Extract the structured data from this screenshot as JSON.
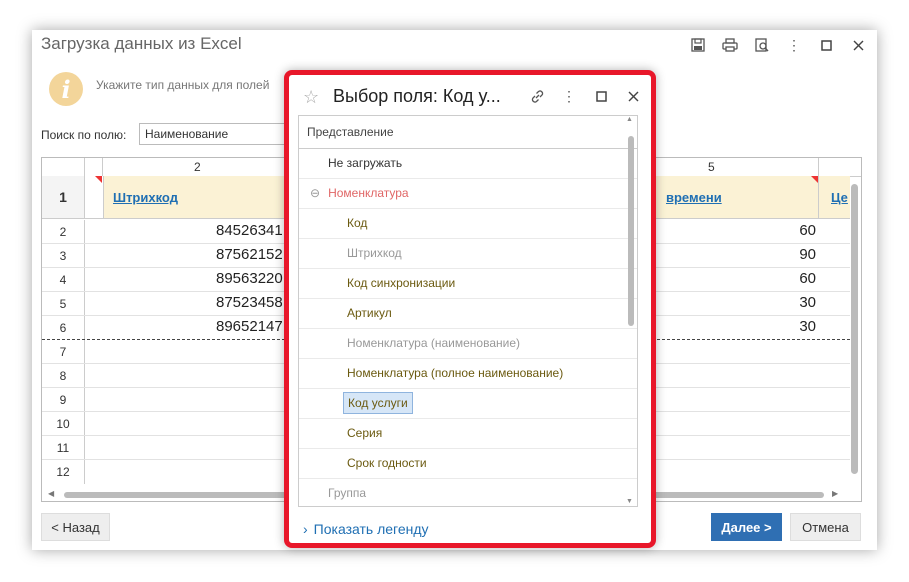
{
  "window": {
    "title": "Загрузка данных из Excel",
    "info_text": "Укажите тип данных для полей",
    "search_label": "Поиск по полю:",
    "search_value": "Наименование",
    "back_label": "< Назад",
    "next_label": "Далее >",
    "cancel_label": "Отмена"
  },
  "grid": {
    "col_numbers": [
      "2",
      "5"
    ],
    "header_links": [
      "Штрихкод",
      "времени",
      "Це"
    ],
    "row_numbers": [
      "1",
      "2",
      "3",
      "4",
      "5",
      "6",
      "7",
      "8",
      "9",
      "10",
      "11",
      "12"
    ],
    "barcodes": [
      "84526341",
      "87562152",
      "89563220",
      "87523458",
      "89652147"
    ],
    "times": [
      "60",
      "90",
      "60",
      "30",
      "30"
    ]
  },
  "modal": {
    "title": "Выбор поля: Код у...",
    "list_header": "Представление",
    "items": [
      {
        "label": "Не загружать"
      },
      {
        "label": "Номенклатура"
      },
      {
        "label": "Код"
      },
      {
        "label": "Штрихкод"
      },
      {
        "label": "Код синхронизации"
      },
      {
        "label": "Артикул"
      },
      {
        "label": "Номенклатура (наименование)"
      },
      {
        "label": "Номенклатура (полное наименование)"
      },
      {
        "label": "Код услуги"
      },
      {
        "label": "Серия"
      },
      {
        "label": "Срок годности"
      },
      {
        "label": "Группа"
      }
    ],
    "legend_label": "Показать легенду"
  },
  "colors": {
    "highlight_border": "#e8172a",
    "accent": "#2f6fb3",
    "link": "#1f6fb3"
  }
}
